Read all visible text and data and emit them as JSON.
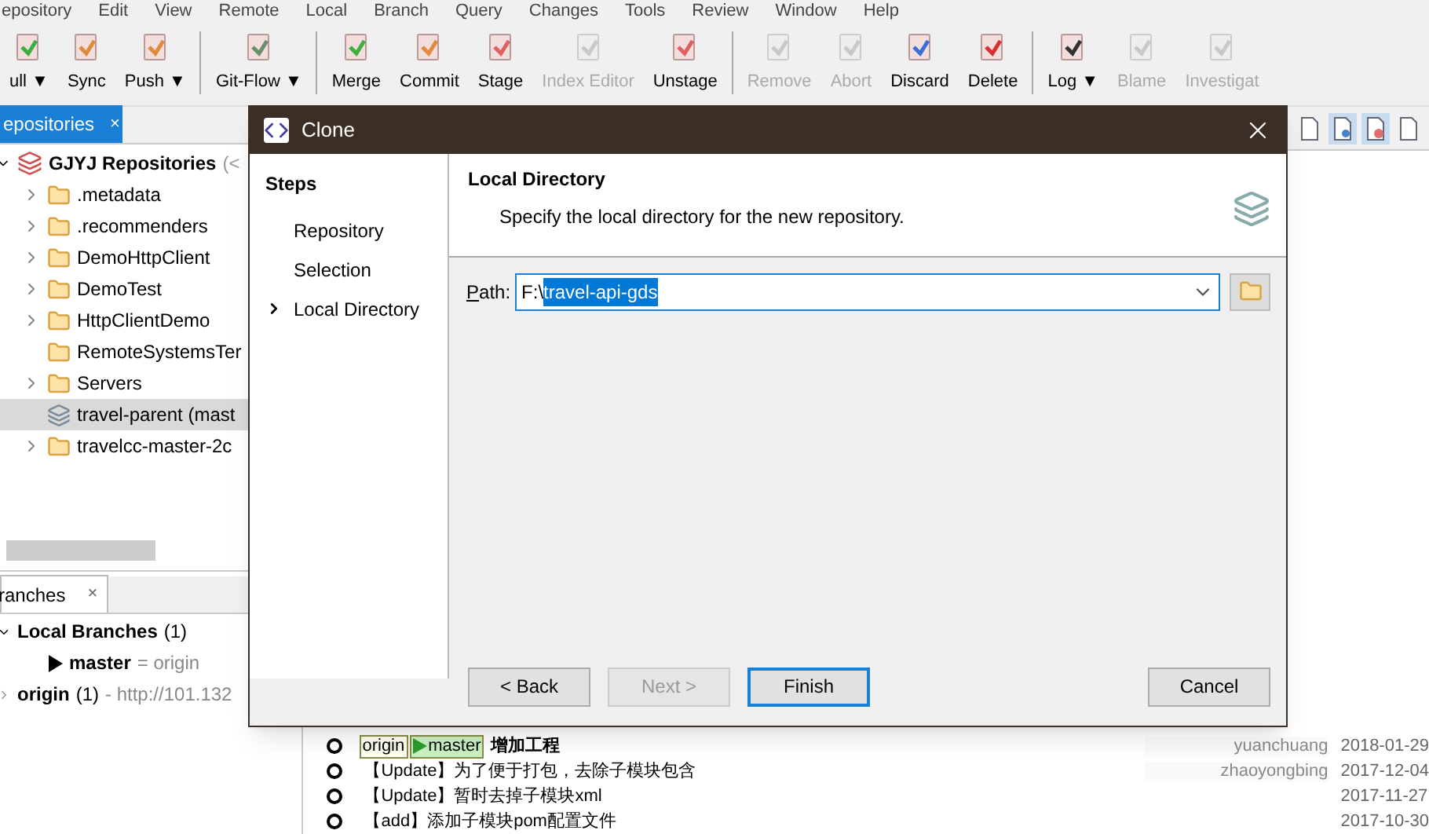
{
  "menu": [
    "epository",
    "Edit",
    "View",
    "Remote",
    "Local",
    "Branch",
    "Query",
    "Changes",
    "Tools",
    "Review",
    "Window",
    "Help"
  ],
  "toolbar": [
    {
      "label": "ull ▼",
      "disabled": false
    },
    {
      "label": "Sync",
      "disabled": false
    },
    {
      "label": "Push ▼",
      "disabled": false
    },
    {
      "label": "Git-Flow ▼",
      "disabled": false
    },
    {
      "label": "Merge",
      "disabled": false
    },
    {
      "label": "Commit",
      "disabled": false
    },
    {
      "label": "Stage",
      "disabled": false
    },
    {
      "label": "Index Editor",
      "disabled": true
    },
    {
      "label": "Unstage",
      "disabled": false
    },
    {
      "label": "Remove",
      "disabled": true
    },
    {
      "label": "Abort",
      "disabled": true
    },
    {
      "label": "Discard",
      "disabled": false
    },
    {
      "label": "Delete",
      "disabled": false
    },
    {
      "label": "Log ▼",
      "disabled": false
    },
    {
      "label": "Blame",
      "disabled": true
    },
    {
      "label": "Investigat",
      "disabled": true
    }
  ],
  "repositories": {
    "tab": "epositories",
    "close": "×",
    "root": {
      "name": "GJYJ Repositories",
      "suffix": "(<"
    },
    "items": [
      {
        "name": ".metadata",
        "expandable": true,
        "selected": false,
        "kind": "folder"
      },
      {
        "name": ".recommenders",
        "expandable": true,
        "selected": false,
        "kind": "folder"
      },
      {
        "name": "DemoHttpClient",
        "expandable": true,
        "selected": false,
        "kind": "folder"
      },
      {
        "name": "DemoTest",
        "expandable": true,
        "selected": false,
        "kind": "folder"
      },
      {
        "name": "HttpClientDemo",
        "expandable": true,
        "selected": false,
        "kind": "folder"
      },
      {
        "name": "RemoteSystemsTer",
        "expandable": false,
        "selected": false,
        "kind": "folder"
      },
      {
        "name": "Servers",
        "expandable": true,
        "selected": false,
        "kind": "folder"
      },
      {
        "name": "travel-parent (mast",
        "expandable": false,
        "selected": true,
        "kind": "repo"
      },
      {
        "name": "travelcc-master-2c",
        "expandable": true,
        "selected": false,
        "kind": "folder"
      }
    ]
  },
  "branches": {
    "tab": "ranches",
    "close": "×",
    "groups": [
      {
        "name": "Local Branches",
        "count": "(1)",
        "expanded": true,
        "children": [
          {
            "name": "master",
            "detail": "= origin"
          }
        ]
      },
      {
        "name": "origin",
        "count": "(1)",
        "expanded": false,
        "detail": "- http://101.132"
      }
    ]
  },
  "commits": [
    {
      "tags": [
        {
          "text": "origin",
          "kind": "remote"
        },
        {
          "text": "master",
          "kind": "local"
        }
      ],
      "message": "增加工程",
      "author": "yuanchuang",
      "date": "2018-01-29"
    },
    {
      "message": "【Update】为了便于打包，去除子模块包含",
      "author": "zhaoyongbing",
      "date": "2017-12-04"
    },
    {
      "message": "【Update】暂时去掉子模块xml",
      "date": "2017-11-27"
    },
    {
      "message": "【add】添加子模块pom配置文件",
      "date": "2017-10-30"
    }
  ],
  "dialog": {
    "title": "Clone",
    "steps_title": "Steps",
    "steps": [
      {
        "label": "Repository",
        "selected": false
      },
      {
        "label": "Selection",
        "selected": false
      },
      {
        "label": "Local Directory",
        "selected": true
      }
    ],
    "heading": "Local Directory",
    "description": "Specify the local directory for the new repository.",
    "path_label": "Path:",
    "path_parts": [
      {
        "text": "F:\\",
        "selected": false
      },
      {
        "text": "travel-api-gds",
        "selected": true
      }
    ],
    "buttons": [
      {
        "label": "< Back",
        "disabled": false,
        "default": false
      },
      {
        "label": "Next >",
        "disabled": true,
        "default": false
      },
      {
        "label": "Finish",
        "disabled": false,
        "default": true
      },
      {
        "label": "Cancel",
        "disabled": false,
        "default": false
      }
    ]
  }
}
